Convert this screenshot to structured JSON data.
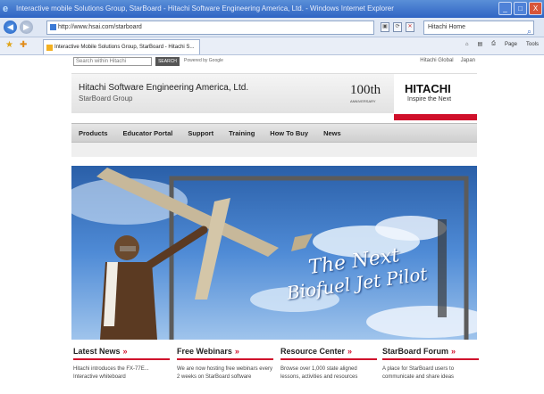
{
  "window": {
    "title": "Interactive mobile Solutions Group, StarBoard - Hitachi Software Engineering America, Ltd. - Windows Internet Explorer",
    "buttons": {
      "minimize": "_",
      "maximize": "□",
      "close": "X"
    }
  },
  "address_bar": {
    "url": "http://www.hsai.com/starboard",
    "search_placeholder": "Hitachi Home"
  },
  "tab": {
    "title": "Interactive Mobile Solutions Group, StarBoard - Hitachi S..."
  },
  "toolbar": {
    "home": "⌂",
    "feeds": "▤",
    "print": "⎙",
    "page": "Page",
    "tools": "Tools"
  },
  "site": {
    "search_placeholder": "Search within Hitachi",
    "search_button": "SEARCH",
    "powered_by": "Powered by Google",
    "top_links": [
      "Hitachi Global",
      "Japan"
    ],
    "company": "Hitachi Software Engineering America, Ltd.",
    "group": "StarBoard Group",
    "anniversary": "100th",
    "anniversary_sub": "ANNIVERSARY",
    "logo": "HITACHI",
    "logo_tagline": "Inspire the Next",
    "nav": [
      "Products",
      "Educator Portal",
      "Support",
      "Training",
      "How To Buy",
      "News"
    ],
    "hero": {
      "line1": "The Next",
      "line2": "Biofuel Jet Pilot"
    },
    "columns": [
      {
        "title": "Latest News",
        "arrow": "»",
        "body": "Hitachi introduces the FX-77E... Interactive whiteboard"
      },
      {
        "title": "Free Webinars",
        "arrow": "»",
        "body": "We are now hosting free webinars every 2 weeks on StarBoard software"
      },
      {
        "title": "Resource Center",
        "arrow": "»",
        "body": "Browse over 1,000 state aligned lessons, activities and resources"
      },
      {
        "title": "StarBoard Forum",
        "arrow": "»",
        "body": "A place for StarBoard users to communicate and share ideas"
      }
    ]
  }
}
